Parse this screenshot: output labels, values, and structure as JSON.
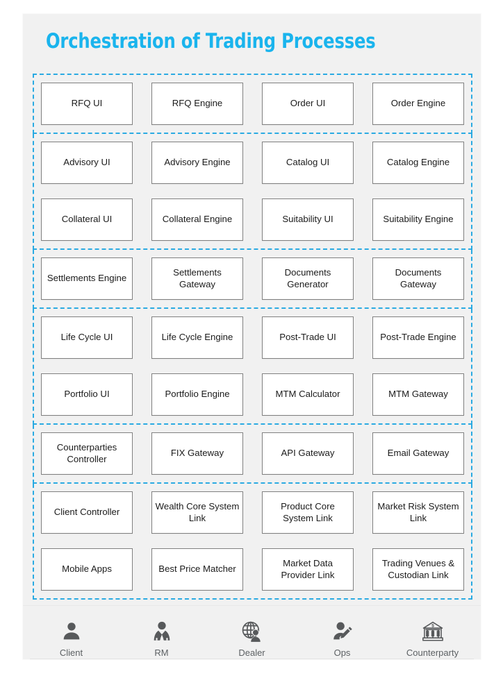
{
  "page": {
    "title": "Orchestration of Trading Processes",
    "accent_color": "#1ab4ed",
    "card_background": "#f1f1f1",
    "node_background": "#ffffff",
    "node_border_color": "#808080",
    "group_border_color": "#2aaae2",
    "icon_color": "#57595b"
  },
  "diagram": {
    "groups": [
      {
        "rows": [
          {
            "nodes": [
              {
                "label": "RFQ UI"
              },
              {
                "label": "RFQ Engine"
              },
              {
                "label": "Order UI"
              },
              {
                "label": "Order Engine"
              }
            ]
          }
        ]
      },
      {
        "rows": [
          {
            "nodes": [
              {
                "label": "Advisory UI"
              },
              {
                "label": "Advisory Engine"
              },
              {
                "label": "Catalog UI"
              },
              {
                "label": "Catalog Engine"
              }
            ]
          },
          {
            "nodes": [
              {
                "label": "Collateral UI"
              },
              {
                "label": "Collateral Engine"
              },
              {
                "label": "Suitability UI"
              },
              {
                "label": "Suitability Engine"
              }
            ]
          }
        ]
      },
      {
        "rows": [
          {
            "nodes": [
              {
                "label": "Settlements Engine"
              },
              {
                "label": "Settlements Gateway"
              },
              {
                "label": "Documents Generator"
              },
              {
                "label": "Documents Gateway"
              }
            ]
          }
        ]
      },
      {
        "rows": [
          {
            "nodes": [
              {
                "label": "Life Cycle UI"
              },
              {
                "label": "Life Cycle Engine"
              },
              {
                "label": "Post-Trade UI"
              },
              {
                "label": "Post-Trade Engine"
              }
            ]
          },
          {
            "nodes": [
              {
                "label": "Portfolio UI"
              },
              {
                "label": "Portfolio Engine"
              },
              {
                "label": "MTM Calculator"
              },
              {
                "label": "MTM Gateway"
              }
            ]
          }
        ]
      },
      {
        "rows": [
          {
            "nodes": [
              {
                "label": "Counterparties Controller"
              },
              {
                "label": "FIX Gateway"
              },
              {
                "label": "API Gateway"
              },
              {
                "label": "Email Gateway"
              }
            ]
          }
        ]
      },
      {
        "rows": [
          {
            "nodes": [
              {
                "label": "Client Controller"
              },
              {
                "label": "Wealth Core System Link"
              },
              {
                "label": "Product Core System Link"
              },
              {
                "label": "Market Risk System Link"
              }
            ]
          },
          {
            "nodes": [
              {
                "label": "Mobile Apps"
              },
              {
                "label": "Best Price Matcher"
              },
              {
                "label": "Market Data Provider Link"
              },
              {
                "label": "Trading Venues & Custodian Link"
              }
            ]
          }
        ]
      }
    ]
  },
  "footer": {
    "actors": [
      {
        "label": "Client",
        "icon": "person-icon"
      },
      {
        "label": "RM",
        "icon": "person-suit-tie-icon"
      },
      {
        "label": "Dealer",
        "icon": "globe-person-icon"
      },
      {
        "label": "Ops",
        "icon": "person-pencil-icon"
      },
      {
        "label": "Counterparty",
        "icon": "bank-dollar-icon"
      }
    ]
  }
}
